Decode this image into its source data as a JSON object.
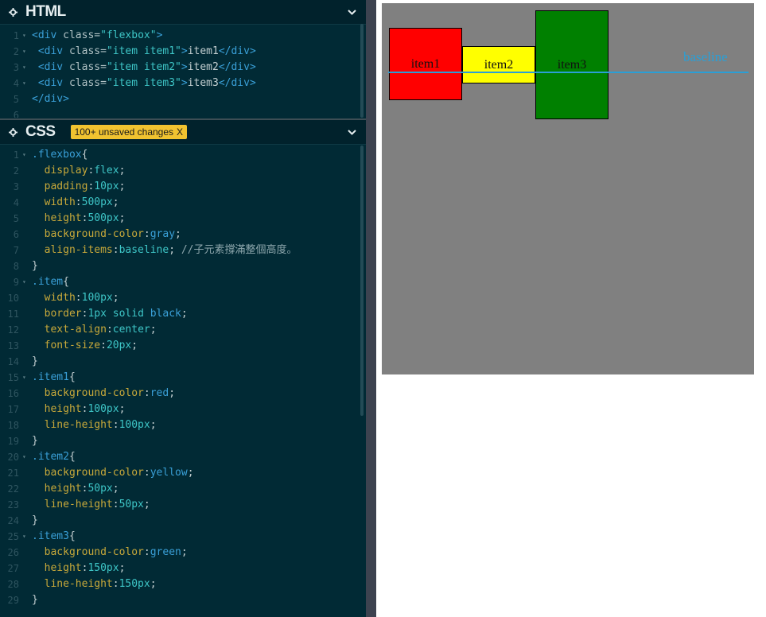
{
  "html_panel": {
    "title": "HTML",
    "lines": [
      {
        "n": "1",
        "fold": "▾",
        "parts": [
          [
            "tag",
            "<div "
          ],
          [
            "attr",
            "class="
          ],
          [
            "str",
            "\"flexbox\""
          ],
          [
            "tag",
            ">"
          ]
        ]
      },
      {
        "n": "2",
        "fold": "▾",
        "parts": [
          [
            "punc",
            " "
          ],
          [
            "tag",
            "<div "
          ],
          [
            "attr",
            "class="
          ],
          [
            "str",
            "\"item item1\""
          ],
          [
            "tag",
            ">"
          ],
          [
            "punc",
            "item1"
          ],
          [
            "tag",
            "</div>"
          ]
        ]
      },
      {
        "n": "3",
        "fold": "▾",
        "parts": [
          [
            "punc",
            " "
          ],
          [
            "tag",
            "<div "
          ],
          [
            "attr",
            "class="
          ],
          [
            "str",
            "\"item item2\""
          ],
          [
            "tag",
            ">"
          ],
          [
            "punc",
            "item2"
          ],
          [
            "tag",
            "</div>"
          ]
        ]
      },
      {
        "n": "4",
        "fold": "▾",
        "parts": [
          [
            "punc",
            " "
          ],
          [
            "tag",
            "<div "
          ],
          [
            "attr",
            "class="
          ],
          [
            "str",
            "\"item item3\""
          ],
          [
            "tag",
            ">"
          ],
          [
            "punc",
            "item3"
          ],
          [
            "tag",
            "</div>"
          ]
        ]
      },
      {
        "n": "5",
        "fold": "",
        "parts": [
          [
            "tag",
            "</div>"
          ]
        ]
      },
      {
        "n": "6",
        "fold": "",
        "parts": []
      }
    ]
  },
  "css_panel": {
    "title": "CSS",
    "unsaved_label": "100+ unsaved changes",
    "unsaved_close": "X",
    "lines": [
      {
        "n": "1",
        "fold": "▾",
        "parts": [
          [
            "sel",
            ".flexbox"
          ],
          [
            "punc",
            "{"
          ]
        ]
      },
      {
        "n": "2",
        "fold": "",
        "parts": [
          [
            "punc",
            "  "
          ],
          [
            "prop",
            "display"
          ],
          [
            "punc",
            ":"
          ],
          [
            "val",
            "flex"
          ],
          [
            "punc",
            ";"
          ]
        ]
      },
      {
        "n": "3",
        "fold": "",
        "parts": [
          [
            "punc",
            "  "
          ],
          [
            "prop",
            "padding"
          ],
          [
            "punc",
            ":"
          ],
          [
            "val",
            "10px"
          ],
          [
            "punc",
            ";"
          ]
        ]
      },
      {
        "n": "4",
        "fold": "",
        "parts": [
          [
            "punc",
            "  "
          ],
          [
            "prop",
            "width"
          ],
          [
            "punc",
            ":"
          ],
          [
            "val",
            "500px"
          ],
          [
            "punc",
            ";"
          ]
        ]
      },
      {
        "n": "5",
        "fold": "",
        "parts": [
          [
            "punc",
            "  "
          ],
          [
            "prop",
            "height"
          ],
          [
            "punc",
            ":"
          ],
          [
            "val",
            "500px"
          ],
          [
            "punc",
            ";"
          ]
        ]
      },
      {
        "n": "6",
        "fold": "",
        "parts": [
          [
            "punc",
            "  "
          ],
          [
            "prop",
            "background-color"
          ],
          [
            "punc",
            ":"
          ],
          [
            "kw",
            "gray"
          ],
          [
            "punc",
            ";"
          ]
        ]
      },
      {
        "n": "7",
        "fold": "",
        "parts": [
          [
            "punc",
            "  "
          ],
          [
            "prop",
            "align-items"
          ],
          [
            "punc",
            ":"
          ],
          [
            "val",
            "baseline"
          ],
          [
            "punc",
            "; "
          ],
          [
            "cmt",
            "//子元素撐滿整個高度。"
          ]
        ]
      },
      {
        "n": "8",
        "fold": "",
        "parts": [
          [
            "punc",
            "}"
          ]
        ]
      },
      {
        "n": "9",
        "fold": "▾",
        "parts": [
          [
            "sel",
            ".item"
          ],
          [
            "punc",
            "{"
          ]
        ]
      },
      {
        "n": "10",
        "fold": "",
        "parts": [
          [
            "punc",
            "  "
          ],
          [
            "prop",
            "width"
          ],
          [
            "punc",
            ":"
          ],
          [
            "val",
            "100px"
          ],
          [
            "punc",
            ";"
          ]
        ]
      },
      {
        "n": "11",
        "fold": "",
        "parts": [
          [
            "punc",
            "  "
          ],
          [
            "prop",
            "border"
          ],
          [
            "punc",
            ":"
          ],
          [
            "val",
            "1px solid "
          ],
          [
            "kw",
            "black"
          ],
          [
            "punc",
            ";"
          ]
        ]
      },
      {
        "n": "12",
        "fold": "",
        "parts": [
          [
            "punc",
            "  "
          ],
          [
            "prop",
            "text-align"
          ],
          [
            "punc",
            ":"
          ],
          [
            "val",
            "center"
          ],
          [
            "punc",
            ";"
          ]
        ]
      },
      {
        "n": "13",
        "fold": "",
        "parts": [
          [
            "punc",
            "  "
          ],
          [
            "prop",
            "font-size"
          ],
          [
            "punc",
            ":"
          ],
          [
            "val",
            "20px"
          ],
          [
            "punc",
            ";"
          ]
        ]
      },
      {
        "n": "14",
        "fold": "",
        "parts": [
          [
            "punc",
            "}"
          ]
        ]
      },
      {
        "n": "15",
        "fold": "▾",
        "parts": [
          [
            "sel",
            ".item1"
          ],
          [
            "punc",
            "{"
          ]
        ]
      },
      {
        "n": "16",
        "fold": "",
        "parts": [
          [
            "punc",
            "  "
          ],
          [
            "prop",
            "background-color"
          ],
          [
            "punc",
            ":"
          ],
          [
            "kw",
            "red"
          ],
          [
            "punc",
            ";"
          ]
        ]
      },
      {
        "n": "17",
        "fold": "",
        "parts": [
          [
            "punc",
            "  "
          ],
          [
            "prop",
            "height"
          ],
          [
            "punc",
            ":"
          ],
          [
            "val",
            "100px"
          ],
          [
            "punc",
            ";"
          ]
        ]
      },
      {
        "n": "18",
        "fold": "",
        "parts": [
          [
            "punc",
            "  "
          ],
          [
            "prop",
            "line-height"
          ],
          [
            "punc",
            ":"
          ],
          [
            "val",
            "100px"
          ],
          [
            "punc",
            ";"
          ]
        ]
      },
      {
        "n": "19",
        "fold": "",
        "parts": [
          [
            "punc",
            "}"
          ]
        ]
      },
      {
        "n": "20",
        "fold": "▾",
        "parts": [
          [
            "sel",
            ".item2"
          ],
          [
            "punc",
            "{"
          ]
        ]
      },
      {
        "n": "21",
        "fold": "",
        "parts": [
          [
            "punc",
            "  "
          ],
          [
            "prop",
            "background-color"
          ],
          [
            "punc",
            ":"
          ],
          [
            "kw",
            "yellow"
          ],
          [
            "punc",
            ";"
          ]
        ]
      },
      {
        "n": "22",
        "fold": "",
        "parts": [
          [
            "punc",
            "  "
          ],
          [
            "prop",
            "height"
          ],
          [
            "punc",
            ":"
          ],
          [
            "val",
            "50px"
          ],
          [
            "punc",
            ";"
          ]
        ]
      },
      {
        "n": "23",
        "fold": "",
        "parts": [
          [
            "punc",
            "  "
          ],
          [
            "prop",
            "line-height"
          ],
          [
            "punc",
            ":"
          ],
          [
            "val",
            "50px"
          ],
          [
            "punc",
            ";"
          ]
        ]
      },
      {
        "n": "24",
        "fold": "",
        "parts": [
          [
            "punc",
            "}"
          ]
        ]
      },
      {
        "n": "25",
        "fold": "▾",
        "parts": [
          [
            "sel",
            ".item3"
          ],
          [
            "punc",
            "{"
          ]
        ]
      },
      {
        "n": "26",
        "fold": "",
        "parts": [
          [
            "punc",
            "  "
          ],
          [
            "prop",
            "background-color"
          ],
          [
            "punc",
            ":"
          ],
          [
            "kw",
            "green"
          ],
          [
            "punc",
            ";"
          ]
        ]
      },
      {
        "n": "27",
        "fold": "",
        "parts": [
          [
            "punc",
            "  "
          ],
          [
            "prop",
            "height"
          ],
          [
            "punc",
            ":"
          ],
          [
            "val",
            "150px"
          ],
          [
            "punc",
            ";"
          ]
        ]
      },
      {
        "n": "28",
        "fold": "",
        "parts": [
          [
            "punc",
            "  "
          ],
          [
            "prop",
            "line-height"
          ],
          [
            "punc",
            ":"
          ],
          [
            "val",
            "150px"
          ],
          [
            "punc",
            ";"
          ]
        ]
      },
      {
        "n": "29",
        "fold": "",
        "parts": [
          [
            "punc",
            "}"
          ]
        ]
      }
    ]
  },
  "preview": {
    "background": "#808080",
    "items": [
      {
        "label": "item1",
        "color": "#ff0000"
      },
      {
        "label": "item2",
        "color": "#ffff00"
      },
      {
        "label": "item3",
        "color": "#008000"
      }
    ],
    "baseline_label": "baseline",
    "baseline_color": "#2a9fd6"
  },
  "icons": {
    "panel_settings": "gear-icon",
    "panel_collapse": "chevron-down-icon"
  }
}
